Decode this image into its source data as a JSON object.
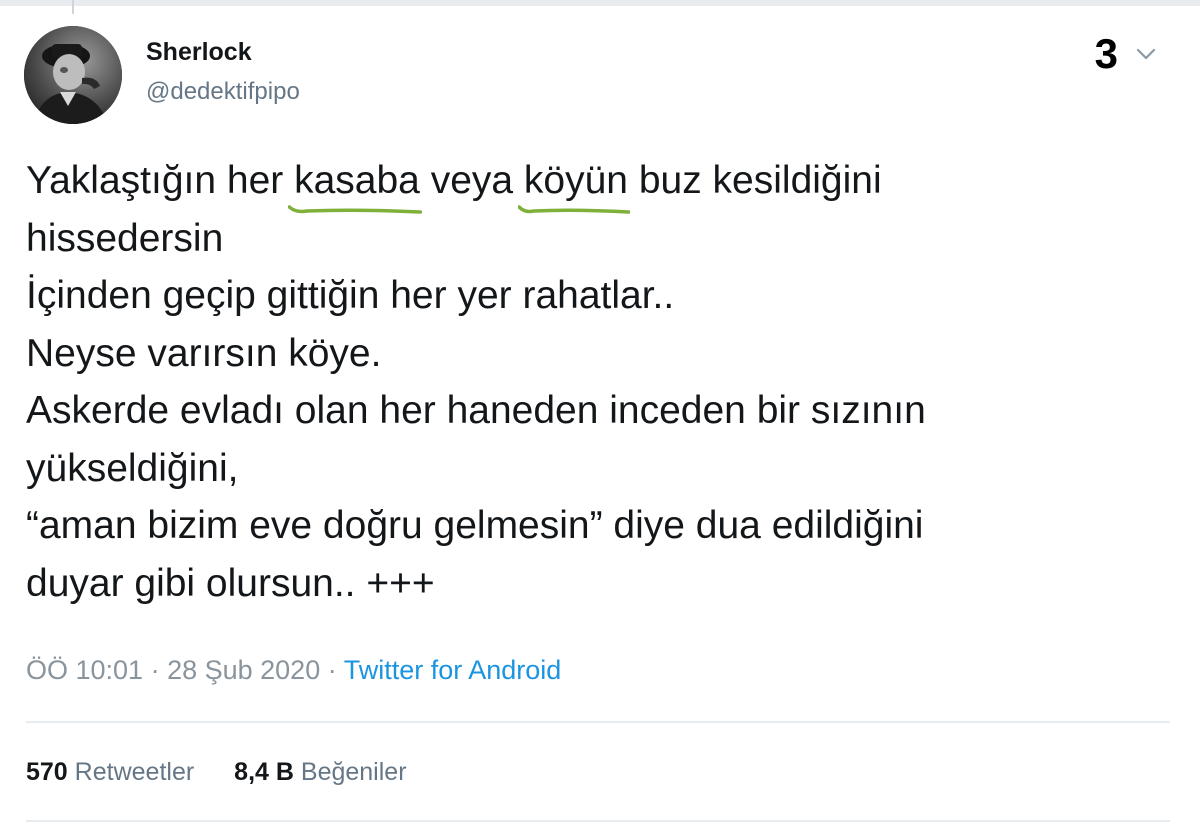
{
  "user": {
    "name": "Sherlock",
    "handle": "@dedektifpipo"
  },
  "badge_number": "3",
  "tweet": {
    "lines": [
      [
        "Yaklaştığın her ",
        "kasaba",
        " veya ",
        "köyün",
        " buz kesildiğini"
      ],
      [
        "hissedersin"
      ],
      [
        "İçinden geçip gittiğin her yer rahatlar.."
      ],
      [
        "Neyse varırsın köye."
      ],
      [
        "Askerde evladı olan her haneden inceden bir sızının"
      ],
      [
        "yükseldiğini,"
      ],
      [
        "“aman bizim eve doğru gelmesin” diye dua edildiğini"
      ],
      [
        "duyar gibi olursun.. +++"
      ]
    ],
    "highlighted_words": [
      "kasaba",
      "köyün"
    ],
    "highlight_color": "#7fb03a"
  },
  "meta": {
    "time_date": "ÖÖ 10:01 · 28 Şub 2020 · ",
    "source": "Twitter for Android"
  },
  "stats": {
    "retweets_count": "570",
    "retweets_label": "Retweetler",
    "likes_count": "8,4 B",
    "likes_label": "Beğeniler"
  },
  "icons": {
    "chevron": "chevron-down-icon",
    "avatar": "profile-photo"
  },
  "colors": {
    "link_blue": "#1b95e0",
    "secondary_gray": "#657786",
    "text": "#14171a"
  }
}
